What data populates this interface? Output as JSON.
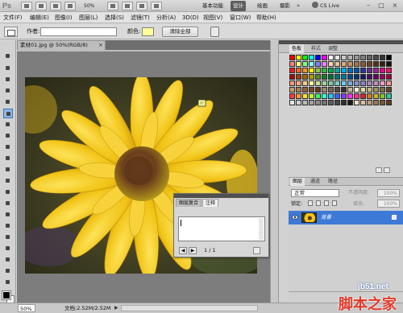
{
  "titlebar": {
    "app_logo": "Ps",
    "zoom": "50%",
    "workspaces": [
      "基本功能",
      "设计",
      "绘画",
      "摄影"
    ],
    "active_workspace": "设计",
    "more": "»",
    "cs_live": "CS Live",
    "win_min": "–",
    "win_max": "□",
    "win_close": "×"
  },
  "menubar": {
    "items": [
      "文件(F)",
      "编辑(E)",
      "图像(I)",
      "图层(L)",
      "选择(S)",
      "滤镜(T)",
      "分析(A)",
      "3D(D)",
      "视图(V)",
      "窗口(W)",
      "帮助(H)"
    ]
  },
  "options": {
    "author_label": "作者:",
    "author_value": "",
    "color_label": "颜色:",
    "color_value": "#ffff99",
    "clear_button": "清除全部"
  },
  "document": {
    "tab_title": "素材01.jpg @ 50%(RGB/8)",
    "tab_close": "×"
  },
  "notes_panel": {
    "tabs": [
      "图层复合",
      "注释"
    ],
    "active_tab": "注释",
    "text": "",
    "page_count": "1 / 1"
  },
  "swatches_panel": {
    "tabs": [
      "色板",
      "样式",
      "调整"
    ],
    "active_tab": "色板"
  },
  "layers_panel": {
    "tabs": [
      "图层",
      "通道",
      "路径"
    ],
    "active_tab": "图层",
    "blend_mode": "正常",
    "opacity_label": "不透明度:",
    "opacity_value": "100%",
    "lock_label": "锁定:",
    "fill_label": "填充:",
    "fill_value": "100%",
    "layer_name": "背景"
  },
  "status": {
    "zoom": "50%",
    "doc_info": "文档:2.52M/2.52M",
    "arrow": "▶"
  },
  "watermark": {
    "url": "jb51.net",
    "name": "脚本之家"
  },
  "colors": {
    "accent_blue": "#3d79d6",
    "note_color": "#ffff99",
    "watermark_red": "#e53a2a"
  }
}
